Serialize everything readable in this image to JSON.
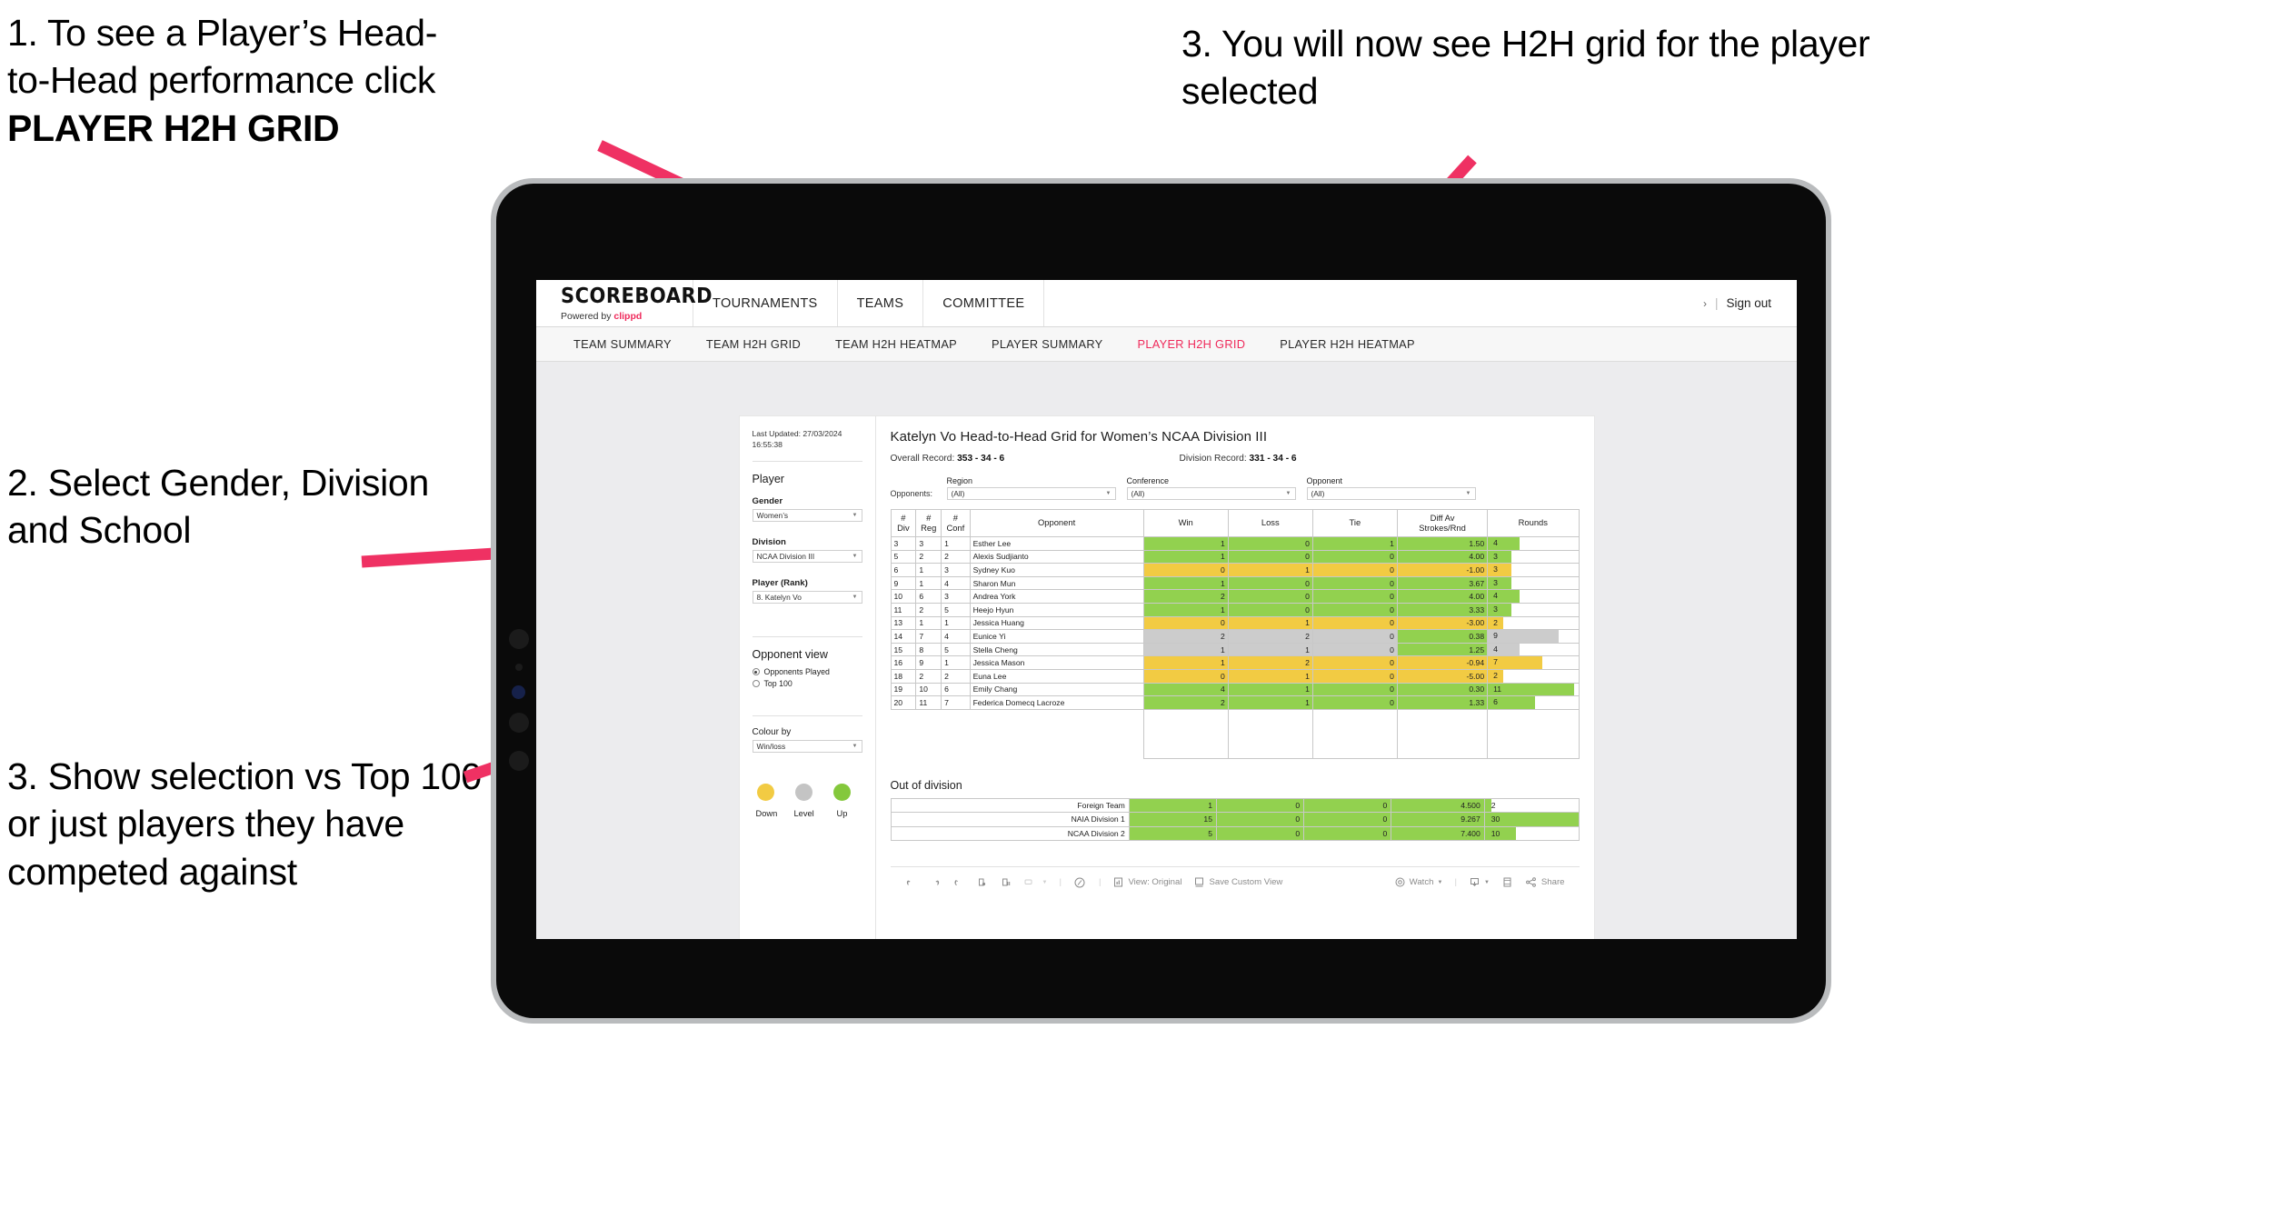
{
  "annotations": [
    {
      "id": "a1",
      "line1": "1. To see a Player’s Head-",
      "line2": "to-Head performance click",
      "line3": "PLAYER H2H GRID"
    },
    {
      "id": "a2",
      "text": "2. Select Gender, Division and School"
    },
    {
      "id": "a3",
      "text": "3. Show selection vs Top 100 or just players they have competed against"
    },
    {
      "id": "a4",
      "text": "3. You will now see H2H grid for the player selected"
    }
  ],
  "colors": {
    "accent_pink": "#ef2a5b",
    "arrow_pink": "#ef3163",
    "green": "#92d14f",
    "yellow": "#f2cb43",
    "grey": "#cccccc"
  },
  "app": {
    "logo": {
      "word": "SCOREBOARD",
      "sub_prefix": "Powered by ",
      "sub_brand": "clippd"
    },
    "top_nav": [
      "TOURNAMENTS",
      "TEAMS",
      "COMMITTEE"
    ],
    "account": {
      "chevron": "›",
      "divider": "|",
      "sign_out": "Sign out"
    },
    "sub_nav": [
      {
        "label": "TEAM SUMMARY",
        "active": false
      },
      {
        "label": "TEAM H2H GRID",
        "active": false
      },
      {
        "label": "TEAM H2H HEATMAP",
        "active": false
      },
      {
        "label": "PLAYER SUMMARY",
        "active": false
      },
      {
        "label": "PLAYER H2H GRID",
        "active": true
      },
      {
        "label": "PLAYER H2H HEATMAP",
        "active": false
      }
    ]
  },
  "sidebar": {
    "last_updated": "Last Updated: 27/03/2024 16:55:38",
    "player_heading": "Player",
    "filters": [
      {
        "label": "Gender",
        "value": "Women’s"
      },
      {
        "label": "Division",
        "value": "NCAA Division III"
      },
      {
        "label": "Player (Rank)",
        "value": "8. Katelyn Vo"
      }
    ],
    "opponent_view": {
      "heading": "Opponent view",
      "options": [
        {
          "label": "Opponents Played",
          "selected": true
        },
        {
          "label": "Top 100",
          "selected": false
        }
      ]
    },
    "colour_by": {
      "label": "Colour by",
      "value": "Win/loss"
    },
    "legend": [
      {
        "label": "Down",
        "color": "#f2cb43"
      },
      {
        "label": "Level",
        "color": "#c4c4c4"
      },
      {
        "label": "Up",
        "color": "#84c83c"
      }
    ]
  },
  "main": {
    "title": "Katelyn Vo Head-to-Head Grid for Women’s NCAA Division III",
    "overall_record_label": "Overall Record: ",
    "overall_record_value": "353 -  34 - 6",
    "division_record_label": "Division Record: ",
    "division_record_value": "331 -  34 - 6",
    "opponents_label": "Opponents:",
    "opponent_filters": [
      {
        "label": "Region",
        "value": "(All)"
      },
      {
        "label": "Conference",
        "value": "(All)"
      },
      {
        "label": "Opponent",
        "value": "(All)"
      }
    ],
    "out_of_division_title": "Out of division"
  },
  "chart_data": {
    "type": "table",
    "title": "Katelyn Vo Head-to-Head Grid for Women’s NCAA Division III",
    "columns": [
      "# Div",
      "# Reg",
      "# Conf",
      "Opponent",
      "Win",
      "Loss",
      "Tie",
      "Diff Av Strokes/Rnd",
      "Rounds"
    ],
    "column_headers_two_line": [
      {
        "top": "#",
        "bottom": "Div"
      },
      {
        "top": "#",
        "bottom": "Reg"
      },
      {
        "top": "#",
        "bottom": "Conf"
      },
      {
        "top": "",
        "bottom": "Opponent"
      },
      {
        "top": "",
        "bottom": "Win"
      },
      {
        "top": "",
        "bottom": "Loss"
      },
      {
        "top": "",
        "bottom": "Tie"
      },
      {
        "top": "Diff Av",
        "bottom": "Strokes/Rnd"
      },
      {
        "top": "",
        "bottom": "Rounds"
      }
    ],
    "rounds_max": 30,
    "rows": [
      {
        "div": "3",
        "reg": "3",
        "conf": "1",
        "opponent": "Esther Lee",
        "win": "1",
        "loss": "0",
        "tie": "1",
        "diff": "1.50",
        "rounds": "4",
        "status": "up"
      },
      {
        "div": "5",
        "reg": "2",
        "conf": "2",
        "opponent": "Alexis Sudjianto",
        "win": "1",
        "loss": "0",
        "tie": "0",
        "diff": "4.00",
        "rounds": "3",
        "status": "up"
      },
      {
        "div": "6",
        "reg": "1",
        "conf": "3",
        "opponent": "Sydney Kuo",
        "win": "0",
        "loss": "1",
        "tie": "0",
        "diff": "-1.00",
        "rounds": "3",
        "status": "down"
      },
      {
        "div": "9",
        "reg": "1",
        "conf": "4",
        "opponent": "Sharon Mun",
        "win": "1",
        "loss": "0",
        "tie": "0",
        "diff": "3.67",
        "rounds": "3",
        "status": "up"
      },
      {
        "div": "10",
        "reg": "6",
        "conf": "3",
        "opponent": "Andrea York",
        "win": "2",
        "loss": "0",
        "tie": "0",
        "diff": "4.00",
        "rounds": "4",
        "status": "up"
      },
      {
        "div": "11",
        "reg": "2",
        "conf": "5",
        "opponent": "Heejo Hyun",
        "win": "1",
        "loss": "0",
        "tie": "0",
        "diff": "3.33",
        "rounds": "3",
        "status": "up"
      },
      {
        "div": "13",
        "reg": "1",
        "conf": "1",
        "opponent": "Jessica Huang",
        "win": "0",
        "loss": "1",
        "tie": "0",
        "diff": "-3.00",
        "rounds": "2",
        "status": "down"
      },
      {
        "div": "14",
        "reg": "7",
        "conf": "4",
        "opponent": "Eunice Yi",
        "win": "2",
        "loss": "2",
        "tie": "0",
        "diff": "0.38",
        "rounds": "9",
        "status": "level",
        "diff_status": "up"
      },
      {
        "div": "15",
        "reg": "8",
        "conf": "5",
        "opponent": "Stella Cheng",
        "win": "1",
        "loss": "1",
        "tie": "0",
        "diff": "1.25",
        "rounds": "4",
        "status": "level",
        "diff_status": "up"
      },
      {
        "div": "16",
        "reg": "9",
        "conf": "1",
        "opponent": "Jessica Mason",
        "win": "1",
        "loss": "2",
        "tie": "0",
        "diff": "-0.94",
        "rounds": "7",
        "status": "down"
      },
      {
        "div": "18",
        "reg": "2",
        "conf": "2",
        "opponent": "Euna Lee",
        "win": "0",
        "loss": "1",
        "tie": "0",
        "diff": "-5.00",
        "rounds": "2",
        "status": "down"
      },
      {
        "div": "19",
        "reg": "10",
        "conf": "6",
        "opponent": "Emily Chang",
        "win": "4",
        "loss": "1",
        "tie": "0",
        "diff": "0.30",
        "rounds": "11",
        "status": "up"
      },
      {
        "div": "20",
        "reg": "11",
        "conf": "7",
        "opponent": "Federica Domecq Lacroze",
        "win": "2",
        "loss": "1",
        "tie": "0",
        "diff": "1.33",
        "rounds": "6",
        "status": "up"
      }
    ],
    "out_of_division": [
      {
        "name": "Foreign Team",
        "win": "1",
        "loss": "0",
        "tie": "0",
        "diff": "4.500",
        "rounds": "2",
        "status": "up"
      },
      {
        "name": "NAIA Division 1",
        "win": "15",
        "loss": "0",
        "tie": "0",
        "diff": "9.267",
        "rounds": "30",
        "status": "up"
      },
      {
        "name": "NCAA Division 2",
        "win": "5",
        "loss": "0",
        "tie": "0",
        "diff": "7.400",
        "rounds": "10",
        "status": "up"
      }
    ]
  },
  "toolbar": {
    "items": [
      {
        "name": "undo-icon",
        "label": ""
      },
      {
        "name": "redo-icon",
        "label": ""
      },
      {
        "name": "revert-icon",
        "label": ""
      },
      {
        "name": "refresh-data-icon",
        "label": ""
      },
      {
        "name": "pause-updates-icon",
        "label": ""
      },
      {
        "name": "highlight-icon",
        "label": ""
      },
      {
        "name": "alerts-icon",
        "label": ""
      },
      {
        "name": "view-original-icon",
        "label": "View: Original"
      },
      {
        "name": "save-custom-view-icon",
        "label": "Save Custom View"
      },
      {
        "name": "watch-icon",
        "label": "Watch"
      },
      {
        "name": "download-icon",
        "label": ""
      },
      {
        "name": "full-screen-icon",
        "label": ""
      },
      {
        "name": "share-icon",
        "label": "Share"
      }
    ]
  }
}
